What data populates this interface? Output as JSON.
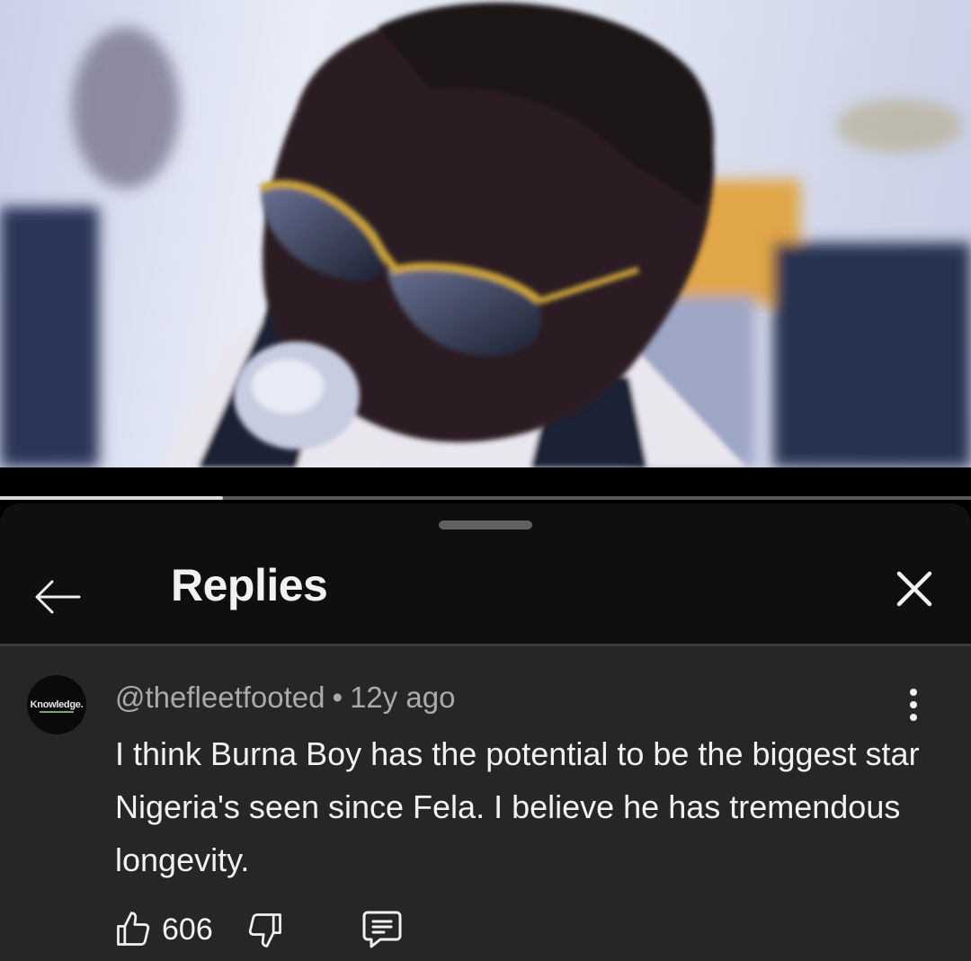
{
  "video": {
    "progress_fraction": 0.23
  },
  "panel": {
    "title": "Replies",
    "back_icon": "arrow-left-icon",
    "close_icon": "close-icon"
  },
  "comment": {
    "avatar_text": "Knowledge.",
    "author": "@thefleetfooted",
    "separator": "•",
    "timestamp": "12y ago",
    "text": "I think Burna Boy has the potential to be the biggest star Nigeria's seen since Fela. I believe he has tremendous longevity.",
    "like_count": "606",
    "menu_icon": "more-vert-icon",
    "like_icon": "thumbs-up-icon",
    "dislike_icon": "thumbs-down-icon",
    "reply_icon": "comment-icon"
  },
  "colors": {
    "sheet_background": "#0f0f0f",
    "comment_background": "#262626",
    "meta_text": "#aaaaaa",
    "primary_text": "#f1f1f1"
  }
}
